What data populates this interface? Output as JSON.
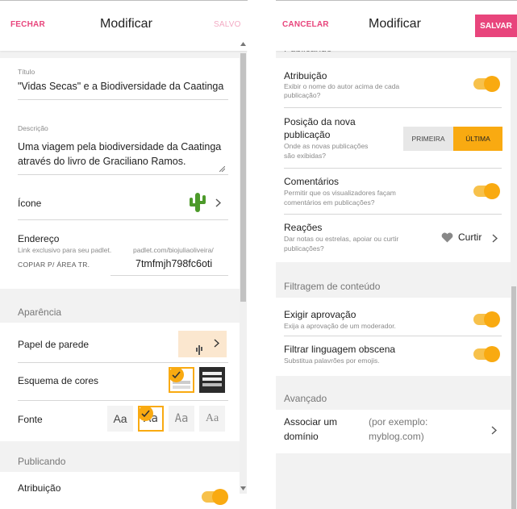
{
  "left": {
    "close_label": "FECHAR",
    "title": "Modificar",
    "saved_label": "SALVO",
    "titulo_label": "Título",
    "titulo_value": "\"Vidas Secas\" e a Biodiversidade da Caatinga",
    "descricao_label": "Descrição",
    "descricao_line1": "Uma viagem pela biodiversidade da Caatinga",
    "descricao_line2": "através do livro de Graciliano Ramos.",
    "icone_label": "Ícone",
    "icone_icon": "cactus-icon",
    "endereco_label": "Endereço",
    "endereco_hint": "Link exclusivo para seu padlet.",
    "endereco_prefix": "padlet.com/biojuliaoliveira/",
    "copy_label": "COPIAR P/ ÁREA TR.",
    "endereco_value": "7tmfmjh798fc6oti",
    "aparencia_heading": "Aparência",
    "papel_label": "Papel de parede",
    "esquema_label": "Esquema de cores",
    "fonte_label": "Fonte",
    "font_options": [
      "Aa",
      "Aa",
      "Aa",
      "Aa"
    ],
    "font_selected_index": 1,
    "publicando_heading": "Publicando",
    "atribuicao_label": "Atribuição",
    "accent_color": "#e8457c",
    "toggle_color": "#f9aa11"
  },
  "right": {
    "cancel_label": "CANCELAR",
    "title": "Modificar",
    "save_label": "SALVAR",
    "publicando_heading": "Publicando",
    "atribuicao_label": "Atribuição",
    "atribuicao_desc_1": "Exibir o nome do autor acima de cada",
    "atribuicao_desc_2": "publicação?",
    "atribuicao_on": true,
    "posicao_label_1": "Posição da nova",
    "posicao_label_2": "publicação",
    "posicao_desc_1": "Onde as novas publicações",
    "posicao_desc_2": "são exibidas?",
    "posicao_first": "PRIMEIRA",
    "posicao_last": "ÚLTIMA",
    "posicao_selected": "ÚLTIMA",
    "comentarios_label": "Comentários",
    "comentarios_desc_1": "Permitir que os visualizadores façam",
    "comentarios_desc_2": "comentários em publicações?",
    "comentarios_on": true,
    "reacoes_label": "Reações",
    "reacoes_desc_1": "Dar notas ou estrelas, apoiar ou curtir",
    "reacoes_desc_2": "publicações?",
    "reacoes_value": "Curtir",
    "filtragem_heading": "Filtragem de conteúdo",
    "aprovacao_label": "Exigir aprovação",
    "aprovacao_desc": "Exija a aprovação de um moderador.",
    "aprovacao_on": true,
    "obscena_label": "Filtrar linguagem obscena",
    "obscena_desc": "Substitua palavrões por emojis.",
    "obscena_on": true,
    "avancado_heading": "Avançado",
    "dominio_label_1": "Associar um",
    "dominio_label_2": "domínio",
    "dominio_hint_1": "(por exemplo:",
    "dominio_hint_2": "myblog.com)"
  }
}
